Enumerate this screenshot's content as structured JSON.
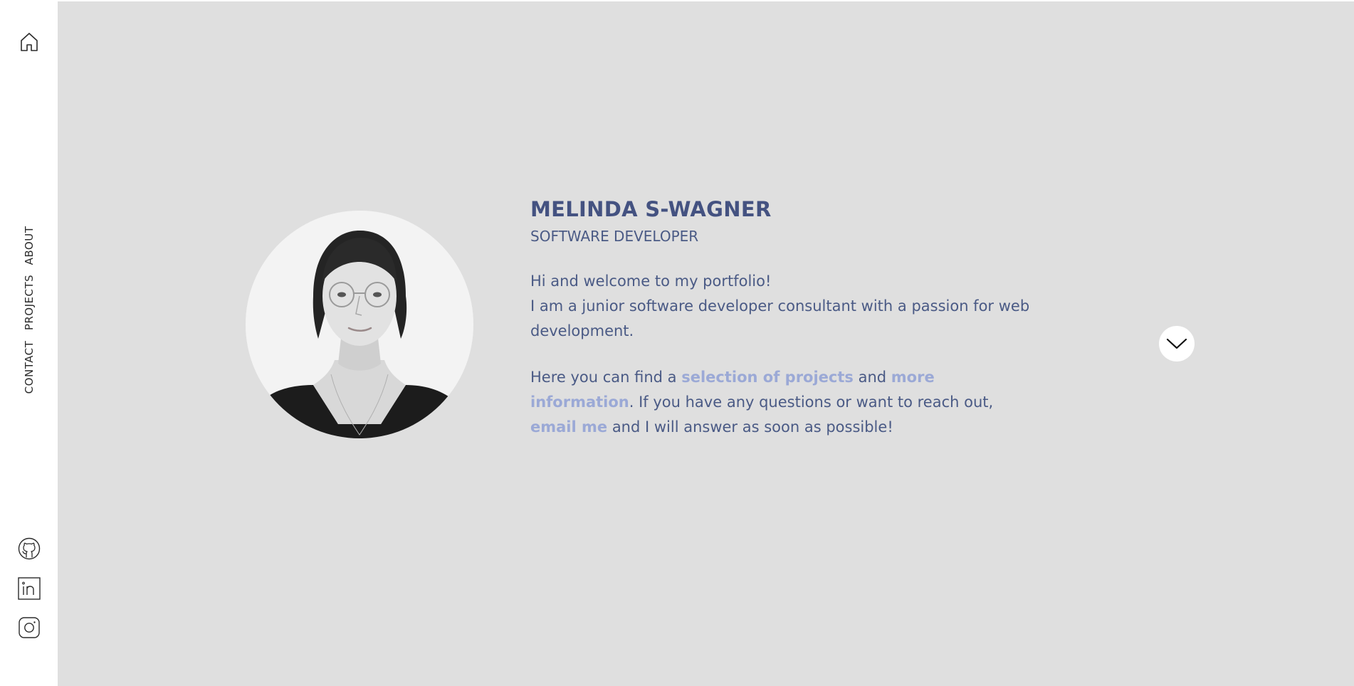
{
  "sidebar": {
    "home_icon": "home-icon",
    "nav": [
      {
        "label": "ABOUT"
      },
      {
        "label": "PROJECTS"
      },
      {
        "label": "CONTACT"
      }
    ],
    "social": [
      {
        "icon": "github-icon"
      },
      {
        "icon": "linkedin-icon"
      },
      {
        "icon": "instagram-icon"
      }
    ]
  },
  "profile": {
    "photo": "profile-photo",
    "name": "MELINDA S-WAGNER",
    "role": "SOFTWARE DEVELOPER"
  },
  "intro": {
    "line1": "Hi and welcome to my portfolio!",
    "line2": "I am a junior software developer consultant with a passion for web development.",
    "p2_before": "Here you can find a ",
    "link_projects": "selection of projects",
    "p2_and": " and ",
    "link_info": "more information",
    "p2_mid": ". If you have any questions or want to reach out, ",
    "link_email": "email me",
    "p2_after": " and I will answer as soon as possible!"
  },
  "scroll": {
    "icon": "chevron-down-icon"
  },
  "colors": {
    "background": "#dfdfdf",
    "sidebar": "#ffffff",
    "heading": "#445281",
    "text": "#4a5a85",
    "link": "#9ba9d6"
  }
}
